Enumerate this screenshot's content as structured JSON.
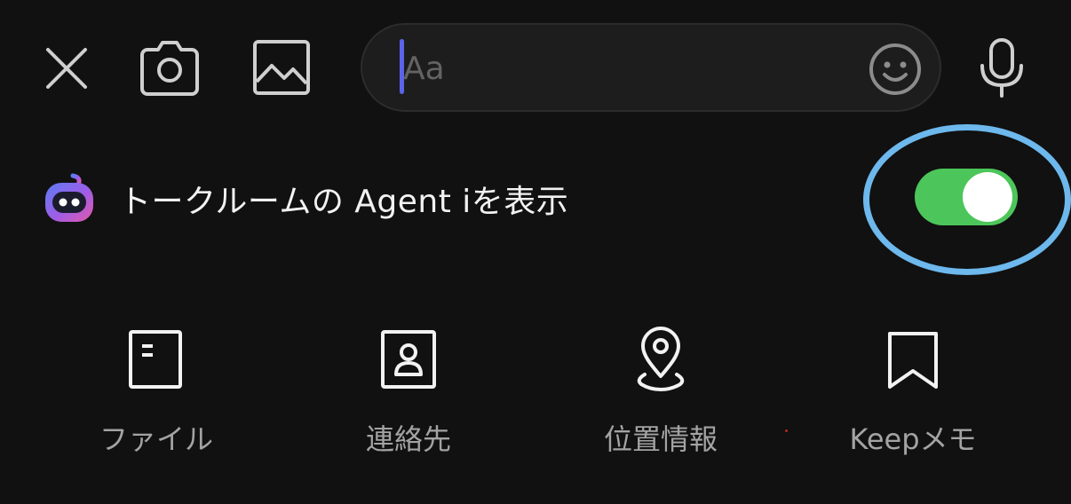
{
  "top_bar": {
    "close_icon": "close-icon",
    "camera_icon": "camera-icon",
    "image_icon": "image-icon",
    "input": {
      "placeholder": "Aa",
      "value": ""
    },
    "emoji_icon": "emoji-icon",
    "mic_icon": "mic-icon"
  },
  "agent": {
    "icon": "agent-i-icon",
    "label": "トークルームの Agent iを表示",
    "toggle_on": true,
    "toggle_color": "#4cc65a",
    "highlight_color": "#6db8ec"
  },
  "actions": [
    {
      "label": "ファイル",
      "icon": "file-icon"
    },
    {
      "label": "連絡先",
      "icon": "contact-icon"
    },
    {
      "label": "位置情報",
      "icon": "location-icon"
    },
    {
      "label": "Keepメモ",
      "icon": "bookmark-icon"
    }
  ],
  "colors": {
    "background": "#111111",
    "caret": "#5b64e8",
    "text_primary": "#f2f2f2",
    "text_secondary": "#a3a3a3",
    "stray_dot": "#b3261e"
  }
}
